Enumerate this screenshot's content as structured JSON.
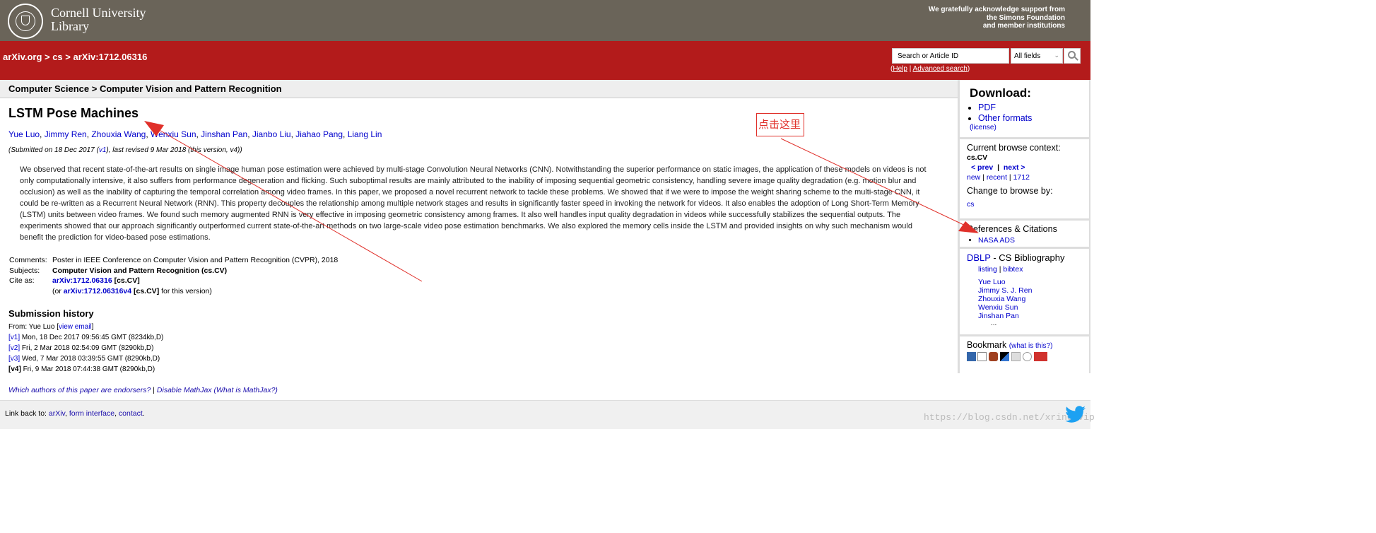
{
  "header": {
    "library_name_line1": "Cornell University",
    "library_name_line2": "Library",
    "support_line1": "We gratefully acknowledge support from",
    "support_line2": "the Simons Foundation",
    "support_line3": "and member institutions"
  },
  "redbar": {
    "breadcrumb": "arXiv.org > cs > arXiv:1712.06316",
    "search_placeholder": "Search or Article ID",
    "search_field": "All fields",
    "help_open": "(",
    "help_label": "Help",
    "help_sep": " | ",
    "advanced_label": "Advanced search",
    "help_close": ")"
  },
  "subject_header": "Computer Science > Computer Vision and Pattern Recognition",
  "paper": {
    "title": "LSTM Pose Machines",
    "authors": [
      "Yue Luo",
      "Jimmy Ren",
      "Zhouxia Wang",
      "Wenxiu Sun",
      "Jinshan Pan",
      "Jianbo Liu",
      "Jiahao Pang",
      "Liang Lin"
    ],
    "submitted_pre": "(Submitted on 18 Dec 2017 (",
    "submitted_v1": "v1",
    "submitted_post": "), last revised 9 Mar 2018 (this version, v4))",
    "abstract": "We observed that recent state-of-the-art results on single image human pose estimation were achieved by multi-stage Convolution Neural Networks (CNN). Notwithstanding the superior performance on static images, the application of these models on videos is not only computationally intensive, it also suffers from performance degeneration and flicking. Such suboptimal results are mainly attributed to the inability of imposing sequential geometric consistency, handling severe image quality degradation (e.g. motion blur and occlusion) as well as the inability of capturing the temporal correlation among video frames. In this paper, we proposed a novel recurrent network to tackle these problems. We showed that if we were to impose the weight sharing scheme to the multi-stage CNN, it could be re-written as a Recurrent Neural Network (RNN). This property decouples the relationship among multiple network stages and results in significantly faster speed in invoking the network for videos. It also enables the adoption of Long Short-Term Memory (LSTM) units between video frames. We found such memory augmented RNN is very effective in imposing geometric consistency among frames. It also well handles input quality degradation in videos while successfully stabilizes the sequential outputs. The experiments showed that our approach significantly outperformed current state-of-the-art methods on two large-scale video pose estimation benchmarks. We also explored the memory cells inside the LSTM and provided insights on why such mechanism would benefit the prediction for video-based pose estimations."
  },
  "meta": {
    "comments_label": "Comments:",
    "comments_value": "Poster in IEEE Conference on Computer Vision and Pattern Recognition (CVPR), 2018",
    "subjects_label": "Subjects:",
    "subjects_value": "Computer Vision and Pattern Recognition (cs.CV)",
    "cite_label": "Cite as:",
    "cite_id": "arXiv:1712.06316",
    "cite_cat": " [cs.CV]",
    "cite2_pre": "(or ",
    "cite2_id": "arXiv:1712.06316v4",
    "cite2_cat": " [cs.CV]",
    "cite2_post": " for this version)"
  },
  "history": {
    "title": "Submission history",
    "from_pre": "From: Yue Luo [",
    "from_link": "view email",
    "from_post": "]",
    "versions": [
      {
        "tag": "[v1]",
        "text": " Mon, 18 Dec 2017 09:56:45 GMT (8234kb,D)"
      },
      {
        "tag": "[v2]",
        "text": " Fri, 2 Mar 2018 02:54:09 GMT (8290kb,D)"
      },
      {
        "tag": "[v3]",
        "text": " Wed, 7 Mar 2018 03:39:55 GMT (8290kb,D)"
      },
      {
        "tag": "[v4]",
        "text": " Fri, 9 Mar 2018 07:44:38 GMT (8290kb,D)"
      }
    ]
  },
  "footer": {
    "endorsers": "Which authors of this paper are endorsers?",
    "sep": " | ",
    "mathjax": "Disable MathJax",
    "whatis_pre": " (",
    "whatis": "What is MathJax?",
    "whatis_post": ")",
    "linkback_label": "Link back to: ",
    "arxiv": "arXiv",
    "comma1": ", ",
    "form": "form interface",
    "comma2": ", ",
    "contact": "contact",
    "period": "."
  },
  "sidebar": {
    "download_title": "Download:",
    "pdf": "PDF",
    "other_formats": "Other formats",
    "license": "(license)",
    "browse_title": "Current browse context:",
    "browse_context": "cs.CV",
    "prev": "< prev",
    "browse_sep": "|",
    "next": "next >",
    "new": "new",
    "sep1": " | ",
    "recent": "recent",
    "sep2": " | ",
    "month": "1712",
    "change_title": "Change to browse by:",
    "cs": "cs",
    "refs_title": "References & Citations",
    "nasa": "NASA ADS",
    "dblp": "DBLP",
    "dblp_rest": " - CS Bibliography",
    "listing": "listing",
    "dblp_sep": " | ",
    "bibtex": "bibtex",
    "dblp_authors": [
      "Yue Luo",
      "Jimmy S. J. Ren",
      "Zhouxia Wang",
      "Wenxiu Sun",
      "Jinshan Pan"
    ],
    "ellipsis": "...",
    "bookmark_title": "Bookmark",
    "what_is_this": "(what is this?)"
  },
  "annotation": {
    "label": "点击这里"
  },
  "watermark": "https://blog.csdn.net/xrinosvip",
  "colors": {
    "header_gray": "#6a6459",
    "arxiv_red": "#b31b1b",
    "link_blue": "#0000cc",
    "annotation_red": "#e0302a"
  }
}
